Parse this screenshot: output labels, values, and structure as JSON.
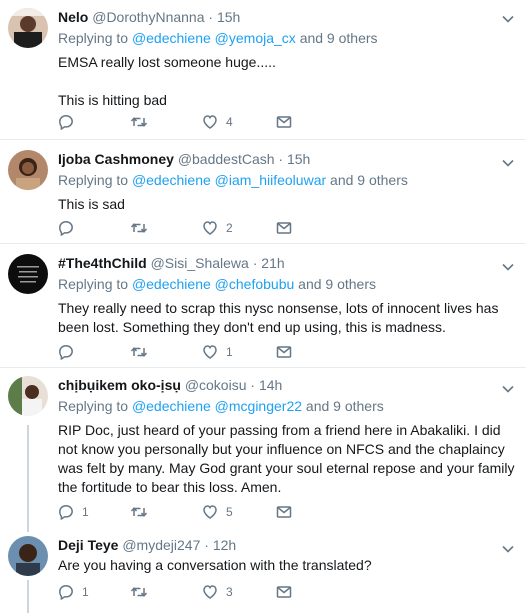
{
  "colors": {
    "link": "#1da1f2",
    "muted": "#657786",
    "text": "#14171a",
    "border": "#e6ecf0"
  },
  "tweets": [
    {
      "name": "Nelo",
      "handle": "@DorothyNnanna",
      "time": "15h",
      "replying_prefix": "Replying to",
      "mention1": "@edechiene",
      "mention2": "@yemoja_cx",
      "others": "and 9 others",
      "text": "EMSA really lost someone huge.....\n\nThis is hitting bad",
      "replies": "",
      "retweets": "",
      "likes": "4"
    },
    {
      "name": "Ijoba Cashmoney",
      "handle": "@baddestCash",
      "time": "15h",
      "replying_prefix": "Replying to",
      "mention1": "@edechiene",
      "mention2": "@iam_hiifeoluwar",
      "others": "and 9 others",
      "text": "This is sad",
      "replies": "",
      "retweets": "",
      "likes": "2"
    },
    {
      "name": "#The4thChild",
      "handle": "@Sisi_Shalewa",
      "time": "21h",
      "replying_prefix": "Replying to",
      "mention1": "@edechiene",
      "mention2": "@chefobubu",
      "others": "and 9 others",
      "text": "They really need to scrap this nysc nonsense, lots of innocent lives has been lost. Something they don't end up using, this is madness.",
      "replies": "",
      "retweets": "",
      "likes": "1"
    },
    {
      "name": "chịbụikem oko-ịsụ",
      "handle": "@cokoisu",
      "time": "14h",
      "replying_prefix": "Replying to",
      "mention1": "@edechiene",
      "mention2": "@mcginger22",
      "others": "and 9 others",
      "text": "RIP Doc, just heard of your passing from a friend here in Abakaliki. I did not know you personally but your influence on NFCS and the chaplaincy was felt by many. May God grant your soul eternal repose and your family the fortitude to bear this loss. Amen.",
      "replies": "1",
      "retweets": "",
      "likes": "5"
    },
    {
      "name": "Deji Teye",
      "handle": "@mydeji247",
      "time": "12h",
      "replying_prefix": "",
      "mention1": "",
      "mention2": "",
      "others": "",
      "text": "Are you having a conversation with the translated?",
      "replies": "1",
      "retweets": "",
      "likes": "3"
    }
  ]
}
